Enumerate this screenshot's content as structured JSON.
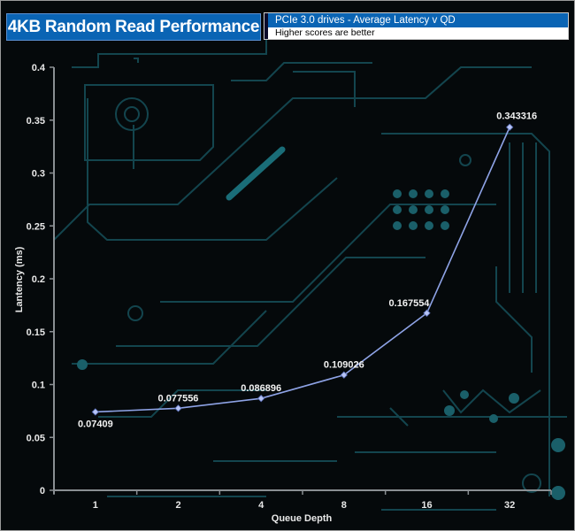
{
  "header": {
    "title": "4KB Random Read Performance",
    "subtitle": "PCIe 3.0 drives - Average Latency  v QD",
    "note": "Higher scores are better"
  },
  "colors": {
    "header_blue": "#0a64b4",
    "line": "#8ea3e6",
    "marker": "#b7c4f5",
    "axis": "#8a8f93",
    "circuit": "#1b5a63"
  },
  "chart_data": {
    "type": "line",
    "categories": [
      "1",
      "2",
      "4",
      "8",
      "16",
      "32"
    ],
    "series": [
      {
        "values": [
          0.07409,
          0.077556,
          0.086896,
          0.109026,
          0.167554,
          0.343316
        ]
      }
    ],
    "data_labels": [
      "0.07409",
      "0.077556",
      "0.086896",
      "0.109026",
      "0.167554",
      "0.343316"
    ],
    "xlabel": "Queue Depth",
    "ylabel": "Lantency (ms)",
    "ylim": [
      0,
      0.4
    ],
    "yticks": [
      0,
      0.05,
      0.1,
      0.15,
      0.2,
      0.25,
      0.3,
      0.35,
      0.4
    ],
    "ytick_labels": [
      "0",
      "0.05",
      "0.1",
      "0.15",
      "0.2",
      "0.25",
      "0.3",
      "0.35",
      "0.4"
    ],
    "grid": false,
    "legend": "none"
  }
}
